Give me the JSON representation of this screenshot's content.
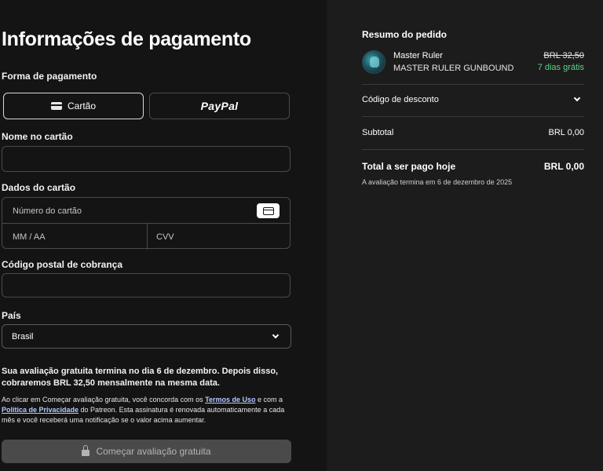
{
  "payment": {
    "title": "Informações de pagamento",
    "method_label": "Forma de pagamento",
    "methods": [
      {
        "label": "Cartão",
        "icon": "credit-card-icon",
        "selected": true
      },
      {
        "label": "PayPal",
        "icon": "paypal-logo",
        "selected": false
      }
    ],
    "name_label": "Nome no cartão",
    "name_value": "",
    "card_label": "Dados do cartão",
    "card_number_placeholder": "Número do cartão",
    "expiry_placeholder": "MM / AA",
    "cvv_placeholder": "CVV",
    "postal_label": "Código postal de cobrança",
    "postal_value": "",
    "country_label": "País",
    "country_value": "Brasil",
    "notice": "Sua avaliação gratuita termina no dia 6 de dezembro. Depois disso, cobraremos BRL 32,50 mensalmente na mesma data.",
    "legal_prefix": "Ao clicar em Começar avaliação gratuita, você concorda com os ",
    "terms_link": "Termos de Uso",
    "legal_mid": " e com a ",
    "privacy_link": "Política de Privacidade",
    "legal_suffix": " do Patreon. Esta assinatura é renovada automaticamente a cada mês e você receberá uma notificação se o valor acima aumentar.",
    "submit_label": "Começar avaliação gratuita"
  },
  "summary": {
    "title": "Resumo do pedido",
    "product_name": "Master Ruler",
    "product_sub": "MASTER RULER GUNBOUND",
    "old_price": "BRL 32,50",
    "trial_text": "7 dias grátis",
    "discount_label": "Código de desconto",
    "subtotal_label": "Subtotal",
    "subtotal_value": "BRL 0,00",
    "total_label": "Total a ser pago hoje",
    "total_value": "BRL 0,00",
    "trial_end": "A avaliação termina em 6 de dezembro de 2025"
  },
  "colors": {
    "left_bg": "#141414",
    "right_bg": "#1c1c1c",
    "trial_green": "#5fd38a",
    "link_blue": "#b5c9ff"
  }
}
